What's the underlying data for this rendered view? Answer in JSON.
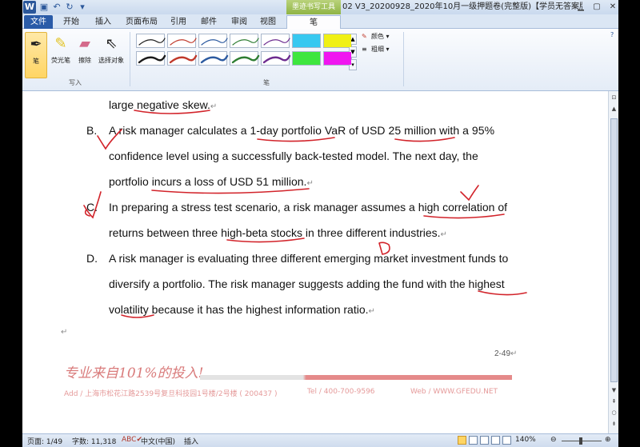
{
  "titlebar": {
    "app_icon": "W",
    "context_tab": "墨迹书写工具",
    "doc_title": "02 V3_20200928_2020年10月一级押题卷(完整版)【学员无答案版...",
    "quick_access": [
      "save-icon",
      "undo-icon",
      "redo-icon",
      "customize-icon"
    ],
    "controls": [
      "minimize-icon",
      "maximize-icon",
      "close-icon"
    ]
  },
  "tabs": [
    "文件",
    "开始",
    "插入",
    "页面布局",
    "引用",
    "邮件",
    "审阅",
    "视图",
    "笔"
  ],
  "ribbon": {
    "write_group": {
      "label": "写入",
      "buttons": [
        "笔",
        "荧光笔",
        "擦除",
        "选择对象"
      ]
    },
    "pens_group": {
      "label": "笔"
    },
    "color_label": "颜色",
    "thickness_label": "粗细",
    "pen_colors": [
      "#1a1a1a",
      "#c0392b",
      "#2c5aa0",
      "#2e7d32",
      "#6d2b8f"
    ],
    "highlighter_colors": [
      "#37c8f0",
      "#f0f016",
      "#3ee63e",
      "#f016f0"
    ]
  },
  "document": {
    "line_end": "large negative skew.",
    "option_b_letter": "B.",
    "option_b": [
      "A risk manager calculates a 1-day portfolio VaR of USD 25 million with a 95%",
      "confidence level using a successfully back-tested model. The next day, the",
      "portfolio incurs a loss of USD 51 million."
    ],
    "option_c_letter": "C.",
    "option_c": [
      "In preparing a stress test scenario, a risk manager assumes a high correlation of",
      "returns between three high-beta stocks in three different industries."
    ],
    "option_d_letter": "D.",
    "option_d": [
      "A risk manager is evaluating three different emerging market investment funds to",
      "diversify a portfolio. The risk manager suggests adding the fund with the highest",
      "volatility because it has the highest information ratio."
    ],
    "para_mark": "↵",
    "page_number": "2-49",
    "slogan": "专业来自101%的投入!",
    "footer_address": "Add / 上海市松花江路2539号复旦科技园1号楼/2号楼 ( 200437 )",
    "footer_tel": "Tel / 400-700-9596",
    "footer_web": "Web / WWW.GFEDU.NET"
  },
  "statusbar": {
    "page": "页面: 1/49",
    "words": "字数: 11,318",
    "language": "中文(中国)",
    "mode": "插入",
    "zoom": "140%"
  }
}
